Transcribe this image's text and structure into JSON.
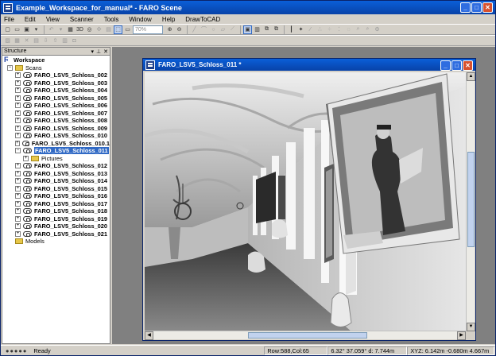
{
  "window": {
    "title": "Example_Workspace_for_manual* - FARO Scene"
  },
  "menu": [
    "File",
    "Edit",
    "View",
    "Scanner",
    "Tools",
    "Window",
    "Help",
    "DrawToCAD"
  ],
  "toolbar": {
    "zoom_value": "70%"
  },
  "panel": {
    "title": "Structure"
  },
  "tree": {
    "workspace": "Workspace",
    "scans_folder": "Scans",
    "scans_before": [
      "FARO_LSV5_Schloss_002",
      "FARO_LSV5_Schloss_003",
      "FARO_LSV5_Schloss_004",
      "FARO_LSV5_Schloss_005",
      "FARO_LSV5_Schloss_006",
      "FARO_LSV5_Schloss_007",
      "FARO_LSV5_Schloss_008",
      "FARO_LSV5_Schloss_009",
      "FARO_LSV5_Schloss_010",
      "FARO_LSV5_Schloss_010.1"
    ],
    "selected_scan": "FARO_LSV5_Schloss_011",
    "pictures_folder": "Pictures",
    "scans_after": [
      "FARO_LSV5_Schloss_012",
      "FARO_LSV5_Schloss_013",
      "FARO_LSV5_Schloss_014",
      "FARO_LSV5_Schloss_015",
      "FARO_LSV5_Schloss_016",
      "FARO_LSV5_Schloss_017",
      "FARO_LSV5_Schloss_018",
      "FARO_LSV5_Schloss_019",
      "FARO_LSV5_Schloss_020",
      "FARO_LSV5_Schloss_021"
    ],
    "models_folder": "Models"
  },
  "scan_window": {
    "title": "FARO_LSV5_Schloss_011 *"
  },
  "status": {
    "ready": "Ready",
    "row_col": "Row:588,Col:65",
    "angle_dist": "6.32° 37.059° d: 7.744m",
    "xyz": "XYZ: 6.142m -0.680m 4.667m"
  }
}
